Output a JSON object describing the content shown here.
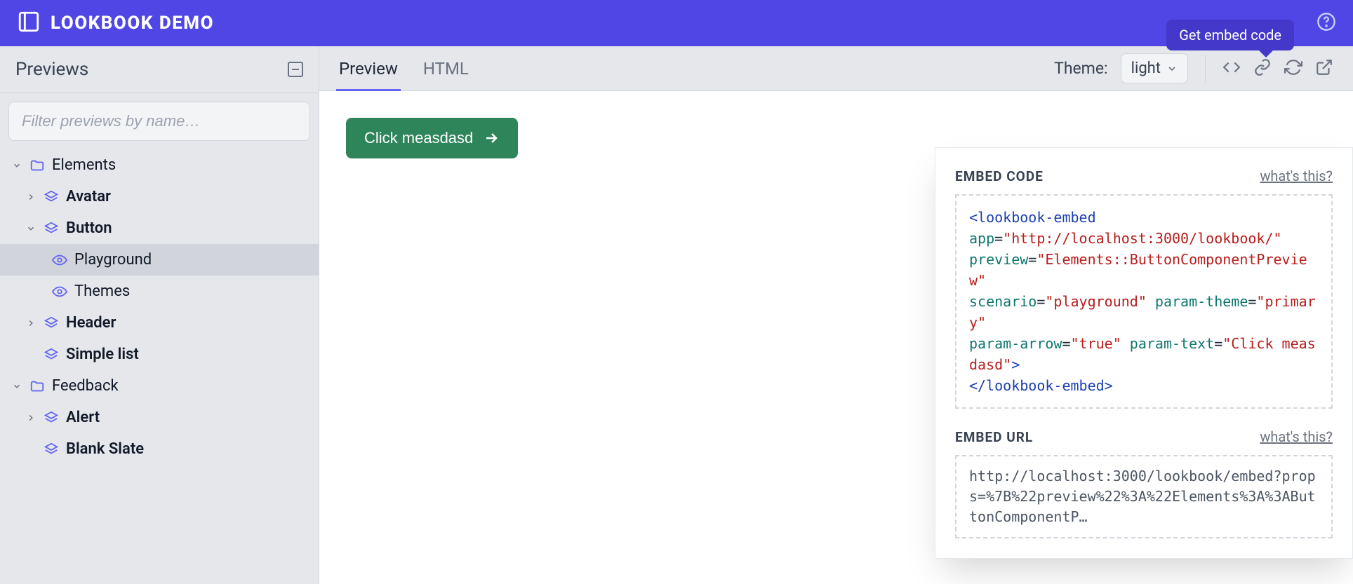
{
  "header": {
    "title": "LOOKBOOK DEMO",
    "tooltip": "Get embed code"
  },
  "sidebar": {
    "title": "Previews",
    "filter_placeholder": "Filter previews by name…",
    "tree": {
      "elements": {
        "label": "Elements"
      },
      "avatar": {
        "label": "Avatar"
      },
      "button": {
        "label": "Button"
      },
      "playground": {
        "label": "Playground"
      },
      "themes": {
        "label": "Themes"
      },
      "header_item": {
        "label": "Header"
      },
      "simple_list": {
        "label": "Simple list"
      },
      "feedback": {
        "label": "Feedback"
      },
      "alert": {
        "label": "Alert"
      },
      "blank_slate": {
        "label": "Blank Slate"
      }
    }
  },
  "toolbar": {
    "tabs": {
      "preview": "Preview",
      "html": "HTML"
    },
    "theme_label": "Theme:",
    "theme_value": "light"
  },
  "preview": {
    "button_text": "Click measdasd"
  },
  "popover": {
    "embed_code_title": "EMBED CODE",
    "embed_url_title": "EMBED URL",
    "whats_this": "what's this?",
    "code": {
      "tag_open": "<lookbook-embed",
      "tag_close": "</lookbook-embed>",
      "attrs": {
        "app_name": "app",
        "app_val": "\"http://localhost:3000/lookbook/\"",
        "preview_name": "preview",
        "preview_val": "\"Elements::ButtonComponentPreview\"",
        "scenario_name": "scenario",
        "scenario_val": "\"playground\"",
        "ptheme_name": "param-theme",
        "ptheme_val": "\"primary\"",
        "parrow_name": "param-arrow",
        "parrow_val": "\"true\"",
        "ptext_name": "param-text",
        "ptext_val": "\"Click measdasd\""
      }
    },
    "url": "http://localhost:3000/lookbook/embed?props=%7B%22preview%22%3A%22Elements%3A%3AButtonComponentP…"
  }
}
